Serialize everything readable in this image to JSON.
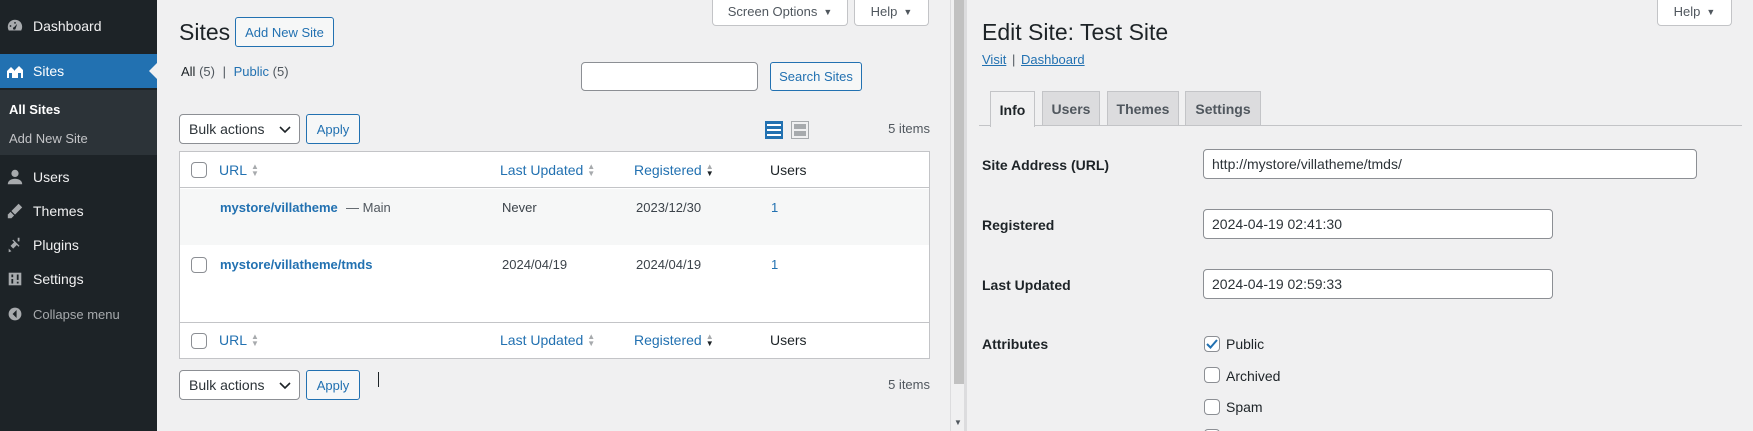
{
  "sidebar": {
    "items": [
      {
        "label": "Dashboard",
        "icon": "dashboard-icon"
      },
      {
        "label": "Sites",
        "icon": "sites-icon"
      },
      {
        "label": "Users",
        "icon": "users-icon"
      },
      {
        "label": "Themes",
        "icon": "themes-icon"
      },
      {
        "label": "Plugins",
        "icon": "plugins-icon"
      },
      {
        "label": "Settings",
        "icon": "settings-icon"
      }
    ],
    "submenu": [
      "All Sites",
      "Add New Site"
    ],
    "collapse": "Collapse menu"
  },
  "left": {
    "title": "Sites",
    "add_new": "Add New Site",
    "screen_options": "Screen Options",
    "help": "Help",
    "filters": {
      "all": "All",
      "all_count": "(5)",
      "sep": "|",
      "public": "Public",
      "public_count": "(5)"
    },
    "search_button": "Search Sites",
    "search_value": "",
    "bulk_actions": "Bulk actions",
    "apply": "Apply",
    "items_count": "5 items",
    "columns": [
      "URL",
      "Last Updated",
      "Registered",
      "Users"
    ],
    "rows": [
      {
        "url": "mystore/villatheme",
        "suffix": "— Main",
        "updated": "Never",
        "registered": "2023/12/30",
        "users": "1"
      },
      {
        "url": "mystore/villatheme/tmds",
        "suffix": "",
        "updated": "2024/04/19",
        "registered": "2024/04/19",
        "users": "1"
      }
    ]
  },
  "right": {
    "title": "Edit Site: Test Site",
    "help": "Help",
    "links": {
      "visit": "Visit",
      "sep": "|",
      "dashboard": "Dashboard"
    },
    "tabs": [
      "Info",
      "Users",
      "Themes",
      "Settings"
    ],
    "fields": {
      "site_address_label": "Site Address (URL)",
      "site_address_value": "http://mystore/villatheme/tmds/",
      "registered_label": "Registered",
      "registered_value": "2024-04-19 02:41:30",
      "last_updated_label": "Last Updated",
      "last_updated_value": "2024-04-19 02:59:33",
      "attributes_label": "Attributes"
    },
    "attributes": [
      {
        "label": "Public",
        "checked": true
      },
      {
        "label": "Archived",
        "checked": false
      },
      {
        "label": "Spam",
        "checked": false
      }
    ]
  },
  "colors": {
    "accent": "#2271b1",
    "sidebar_bg": "#1d2327",
    "page_bg": "#f0f0f1"
  }
}
